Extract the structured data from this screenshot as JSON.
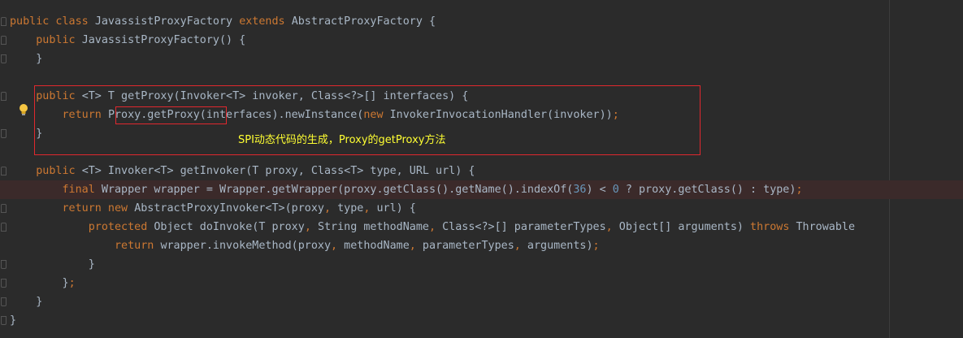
{
  "code": [
    {
      "id": "l1",
      "tokens": [
        {
          "t": "kw",
          "v": "public class "
        },
        {
          "t": "plain",
          "v": "JavassistProxyFactory "
        },
        {
          "t": "kw",
          "v": "extends "
        },
        {
          "t": "plain",
          "v": "AbstractProxyFactory {"
        }
      ]
    },
    {
      "id": "l2",
      "tokens": [
        {
          "t": "plain",
          "v": "    "
        },
        {
          "t": "kw",
          "v": "public "
        },
        {
          "t": "plain",
          "v": "JavassistProxyFactory() {"
        }
      ]
    },
    {
      "id": "l3",
      "tokens": [
        {
          "t": "plain",
          "v": "    }"
        }
      ]
    },
    {
      "id": "l4",
      "tokens": []
    },
    {
      "id": "l5",
      "tokens": [
        {
          "t": "plain",
          "v": "    "
        },
        {
          "t": "kw",
          "v": "public "
        },
        {
          "t": "plain",
          "v": "<T> T getProxy(Invoker<T> invoker, Class<?>[] interfaces) {"
        }
      ]
    },
    {
      "id": "l6",
      "tokens": [
        {
          "t": "plain",
          "v": "        "
        },
        {
          "t": "kw",
          "v": "return "
        },
        {
          "t": "plain",
          "v": "Proxy.getProxy(interfaces).newInstance("
        },
        {
          "t": "kw",
          "v": "new "
        },
        {
          "t": "plain",
          "v": "InvokerInvocationHandler(invoker))"
        },
        {
          "t": "kw",
          "v": ";"
        }
      ]
    },
    {
      "id": "l7",
      "tokens": [
        {
          "t": "plain",
          "v": "    }"
        }
      ]
    },
    {
      "id": "l8",
      "tokens": []
    },
    {
      "id": "l9",
      "tokens": [
        {
          "t": "plain",
          "v": "    "
        },
        {
          "t": "kw",
          "v": "public "
        },
        {
          "t": "plain",
          "v": "<T> Invoker<T> getInvoker(T proxy, Class<T> type, URL url) {"
        }
      ]
    },
    {
      "id": "l10",
      "tokens": [
        {
          "t": "plain",
          "v": "        "
        },
        {
          "t": "kw",
          "v": "final "
        },
        {
          "t": "plain",
          "v": "Wrapper wrapper = Wrapper.getWrapper(proxy.getClass().getName().indexOf("
        },
        {
          "t": "num",
          "v": "36"
        },
        {
          "t": "plain",
          "v": ") < "
        },
        {
          "t": "num",
          "v": "0"
        },
        {
          "t": "plain",
          "v": " ? proxy.getClass() : type)"
        },
        {
          "t": "kw",
          "v": ";"
        }
      ]
    },
    {
      "id": "l11",
      "tokens": [
        {
          "t": "plain",
          "v": "        "
        },
        {
          "t": "kw",
          "v": "return new "
        },
        {
          "t": "plain",
          "v": "AbstractProxyInvoker<T>(proxy"
        },
        {
          "t": "kw",
          "v": ", "
        },
        {
          "t": "plain",
          "v": "type"
        },
        {
          "t": "kw",
          "v": ", "
        },
        {
          "t": "plain",
          "v": "url) {"
        }
      ]
    },
    {
      "id": "l12",
      "tokens": [
        {
          "t": "plain",
          "v": "            "
        },
        {
          "t": "kw",
          "v": "protected "
        },
        {
          "t": "plain",
          "v": "Object doInvoke(T proxy"
        },
        {
          "t": "kw",
          "v": ", "
        },
        {
          "t": "plain",
          "v": "String methodName"
        },
        {
          "t": "kw",
          "v": ", "
        },
        {
          "t": "plain",
          "v": "Class<?>[] parameterTypes"
        },
        {
          "t": "kw",
          "v": ", "
        },
        {
          "t": "plain",
          "v": "Object[] arguments) "
        },
        {
          "t": "kw",
          "v": "throws "
        },
        {
          "t": "plain",
          "v": "Throwable"
        }
      ]
    },
    {
      "id": "l13",
      "tokens": [
        {
          "t": "plain",
          "v": "                "
        },
        {
          "t": "kw",
          "v": "return "
        },
        {
          "t": "plain",
          "v": "wrapper.invokeMethod(proxy"
        },
        {
          "t": "kw",
          "v": ", "
        },
        {
          "t": "plain",
          "v": "methodName"
        },
        {
          "t": "kw",
          "v": ", "
        },
        {
          "t": "plain",
          "v": "parameterTypes"
        },
        {
          "t": "kw",
          "v": ", "
        },
        {
          "t": "plain",
          "v": "arguments)"
        },
        {
          "t": "kw",
          "v": ";"
        }
      ]
    },
    {
      "id": "l14",
      "tokens": [
        {
          "t": "plain",
          "v": "            }"
        }
      ]
    },
    {
      "id": "l15",
      "tokens": [
        {
          "t": "plain",
          "v": "        }"
        },
        {
          "t": "kw",
          "v": ";"
        }
      ]
    },
    {
      "id": "l16",
      "tokens": [
        {
          "t": "plain",
          "v": "    }"
        }
      ]
    },
    {
      "id": "l17",
      "tokens": [
        {
          "t": "plain",
          "v": "}"
        }
      ]
    }
  ],
  "annotation": {
    "text": "SPI动态代码的生成，Proxy的getProxy方法",
    "color": "#ffff32"
  },
  "colors": {
    "background": "#2b2b2b",
    "keyword": "#cc7832",
    "text": "#a9b7c6",
    "number": "#6897bb",
    "highlight_box": "#e0282e",
    "error_line": "#3b2a2a"
  },
  "icons": {
    "intention": "lightbulb-icon",
    "fold": "fold-marker-icon"
  }
}
